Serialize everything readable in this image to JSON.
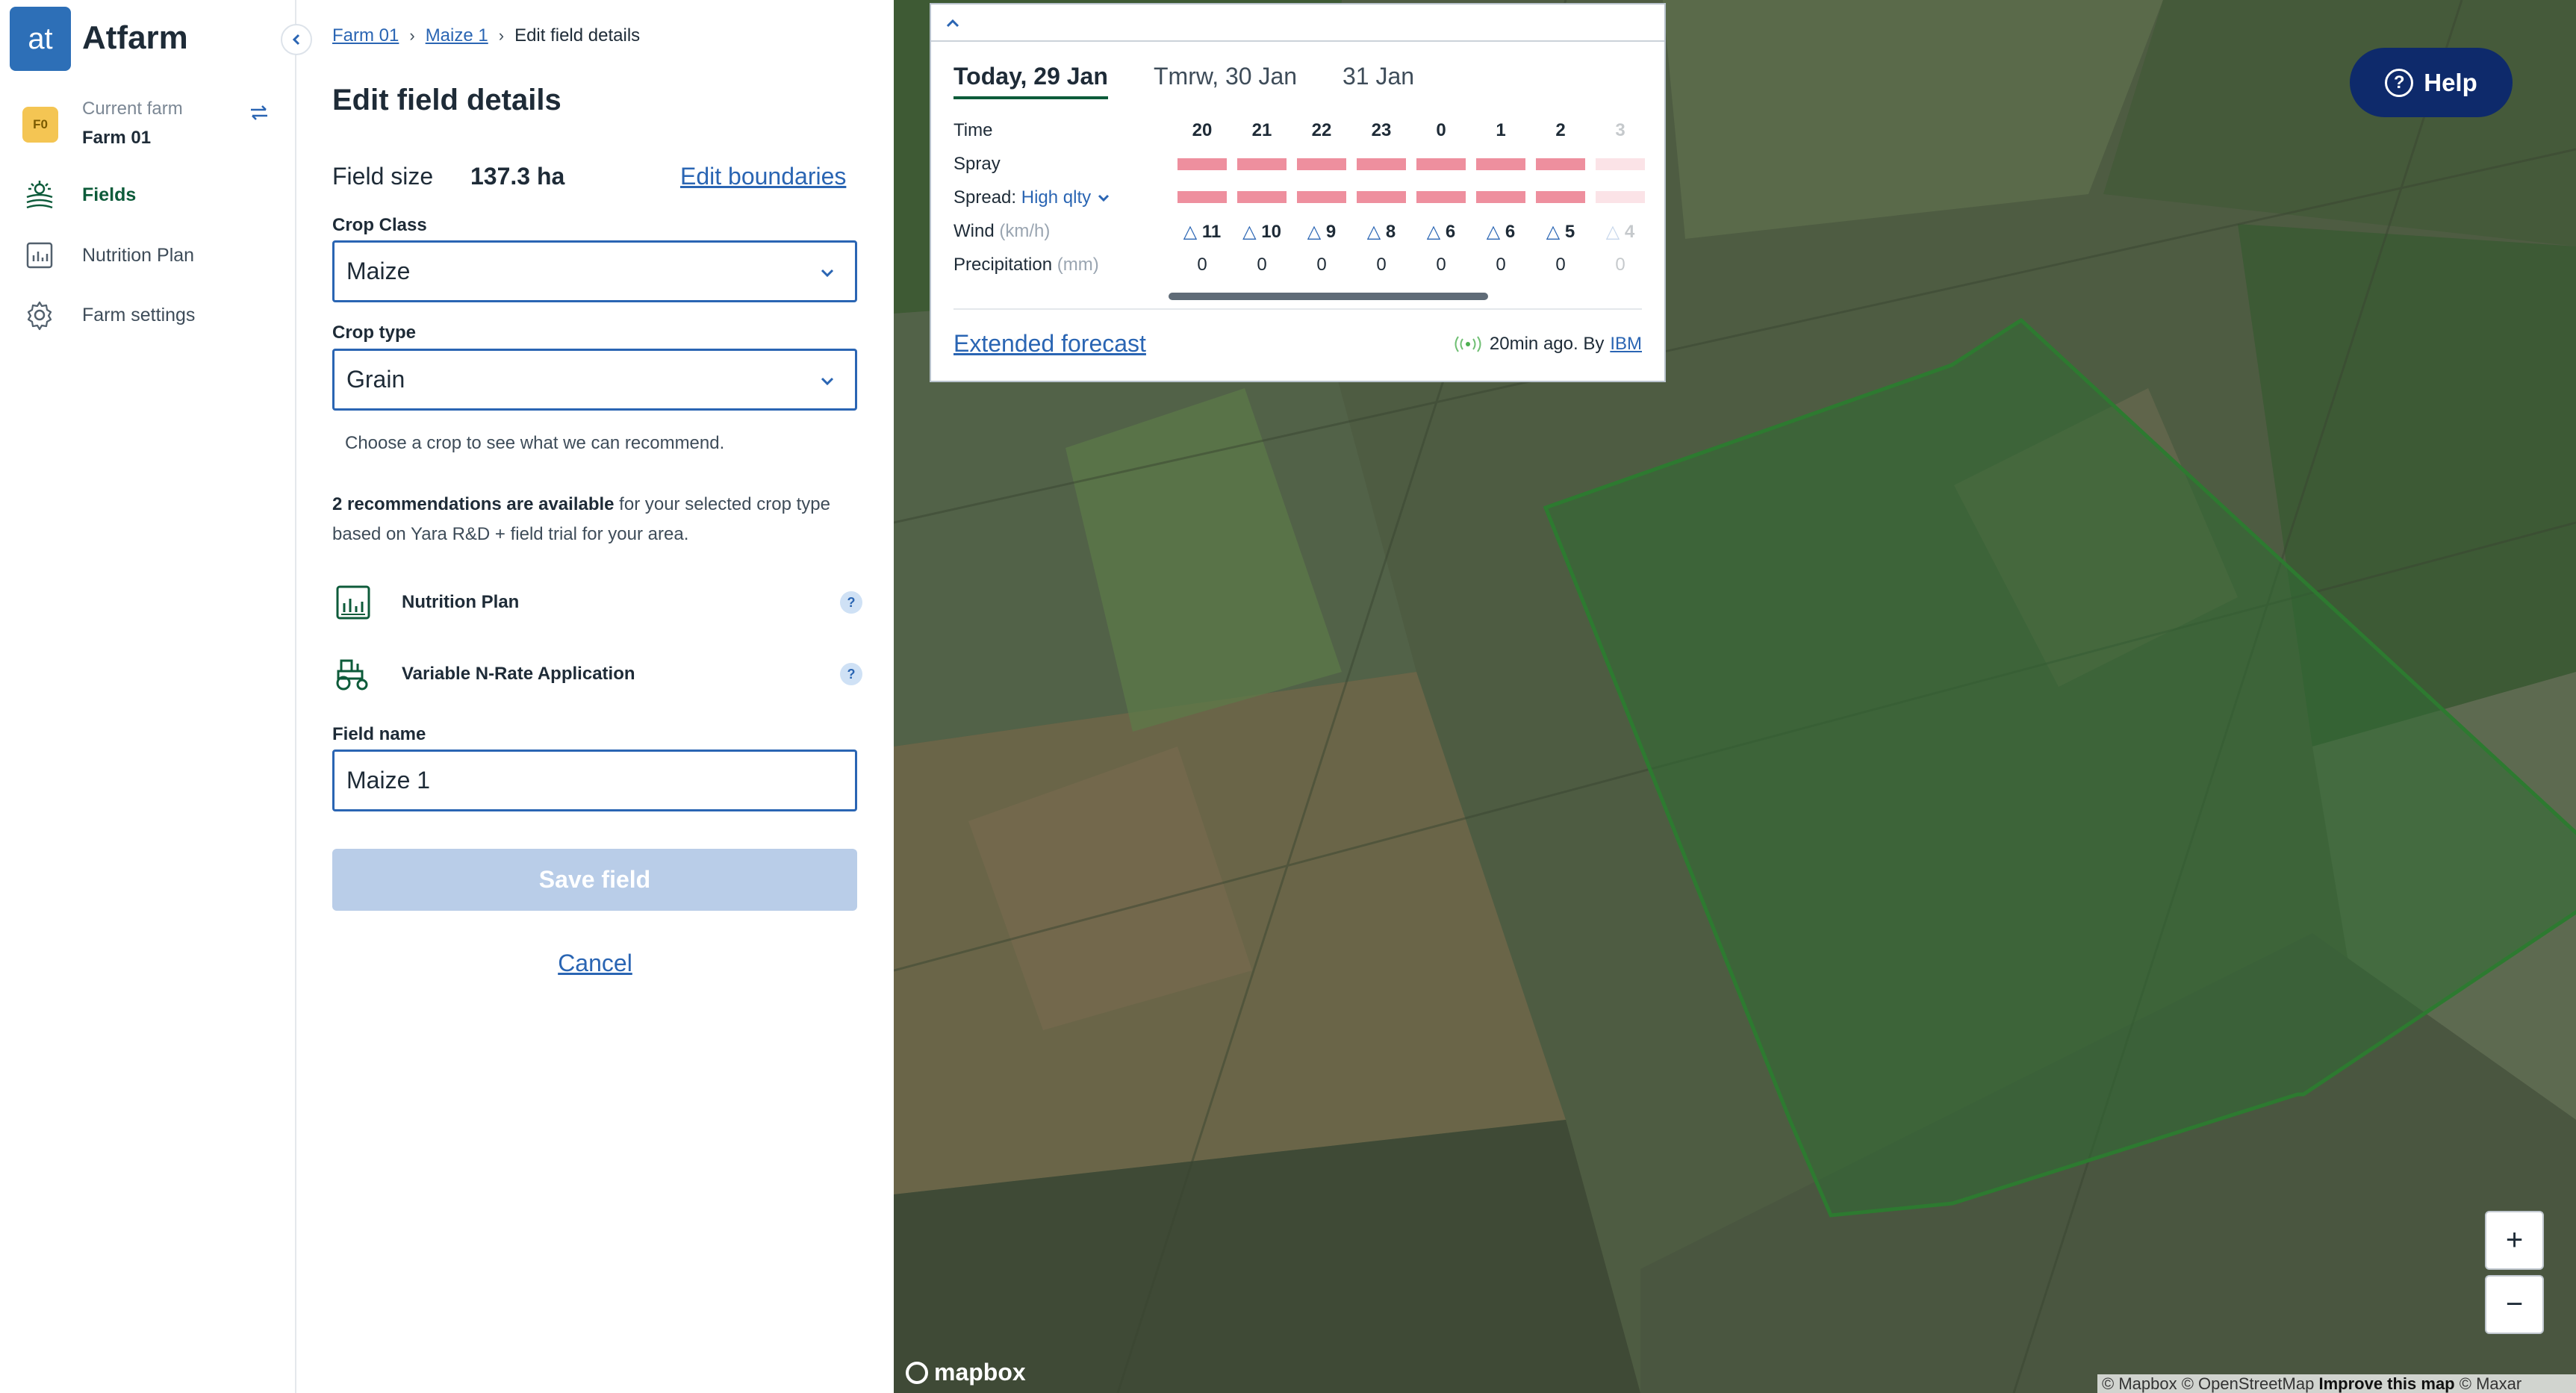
{
  "app": {
    "logo_text": "at",
    "name": "Atfarm",
    "farm_badge": "F0",
    "current_farm_caption": "Current farm",
    "current_farm_name": "Farm 01"
  },
  "nav": {
    "items": [
      {
        "label": "Fields",
        "icon": "fields-icon",
        "active": true
      },
      {
        "label": "Nutrition Plan",
        "icon": "chart-icon",
        "active": false
      },
      {
        "label": "Farm settings",
        "icon": "gear-icon",
        "active": false
      }
    ]
  },
  "breadcrumb": {
    "items": [
      "Farm 01",
      "Maize 1"
    ],
    "current": "Edit field details"
  },
  "form": {
    "title": "Edit field details",
    "field_size_label": "Field size",
    "field_size_value": "137.3 ha",
    "edit_boundaries": "Edit boundaries",
    "crop_class_label": "Crop Class",
    "crop_class_value": "Maize",
    "crop_type_label": "Crop type",
    "crop_type_value": "Grain",
    "hint": "Choose a crop to see what we can recommend.",
    "reco_bold": "2 recommendations are available",
    "reco_rest": " for your selected crop type based on Yara R&D + field trial for your area.",
    "recommendations": [
      {
        "label": "Nutrition Plan",
        "icon": "nutrition-plan-icon"
      },
      {
        "label": "Variable N-Rate Application",
        "icon": "tractor-icon"
      }
    ],
    "help_mark": "?",
    "field_name_label": "Field name",
    "field_name_value": "Maize 1",
    "save": "Save field",
    "cancel": "Cancel"
  },
  "weather": {
    "tabs": [
      "Today, 29 Jan",
      "Tmrw, 30 Jan",
      "31 Jan"
    ],
    "rows": {
      "time": "Time",
      "spray": "Spray",
      "spread": "Spread:",
      "spread_quality": "High qlty",
      "wind": "Wind",
      "wind_unit": "(km/h)",
      "precip": "Precipitation",
      "precip_unit": "(mm)"
    },
    "hours": [
      "20",
      "21",
      "22",
      "23",
      "0",
      "1",
      "2",
      "3"
    ],
    "wind": [
      "11",
      "10",
      "9",
      "8",
      "6",
      "6",
      "5",
      "4"
    ],
    "precip": [
      "0",
      "0",
      "0",
      "0",
      "0",
      "0",
      "0",
      "0"
    ],
    "extended": "Extended forecast",
    "updated": "20min ago. By",
    "source": "IBM",
    "bar_color": "#ee8f9e"
  },
  "map": {
    "help": "Help",
    "help_mark": "?",
    "zoom_in": "+",
    "zoom_out": "−",
    "logo": "mapbox",
    "attribution": "© Mapbox © OpenStreetMap",
    "attribution_bold": "Improve this map",
    "attribution_tail": "© Maxar",
    "field_color": "#2f6b33"
  }
}
